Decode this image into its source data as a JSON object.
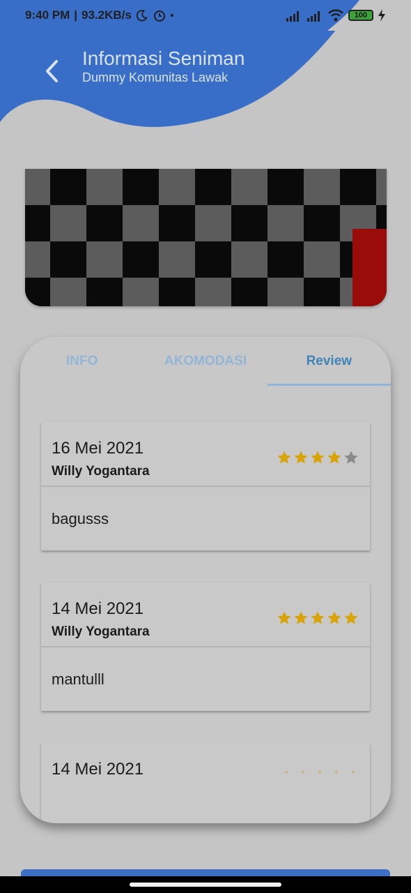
{
  "colors": {
    "header": "#386ec8",
    "star": "#d9a407",
    "star_empty": "#8a8a8a",
    "tab_active": "#3f84b7",
    "tab_inactive": "#93b6d6"
  },
  "status_bar": {
    "time": "9:40 PM",
    "separator": "|",
    "speed": "93.2KB/s",
    "battery": "100"
  },
  "header": {
    "title": "Informasi Seniman",
    "subtitle": "Dummy Komunitas Lawak",
    "back_icon": "chevron-left-icon"
  },
  "tabs": [
    {
      "label": "INFO",
      "active": false
    },
    {
      "label": "AKOMODASI",
      "active": false
    },
    {
      "label": "Review",
      "active": true
    }
  ],
  "reviews": [
    {
      "date": "16 Mei 2021",
      "name": "Willy Yogantara",
      "rating": 4,
      "max": 5,
      "comment": "bagusss"
    },
    {
      "date": "14 Mei 2021",
      "name": "Willy Yogantara",
      "rating": 5,
      "max": 5,
      "comment": "mantulll"
    },
    {
      "date": "14 Mei 2021"
    }
  ]
}
